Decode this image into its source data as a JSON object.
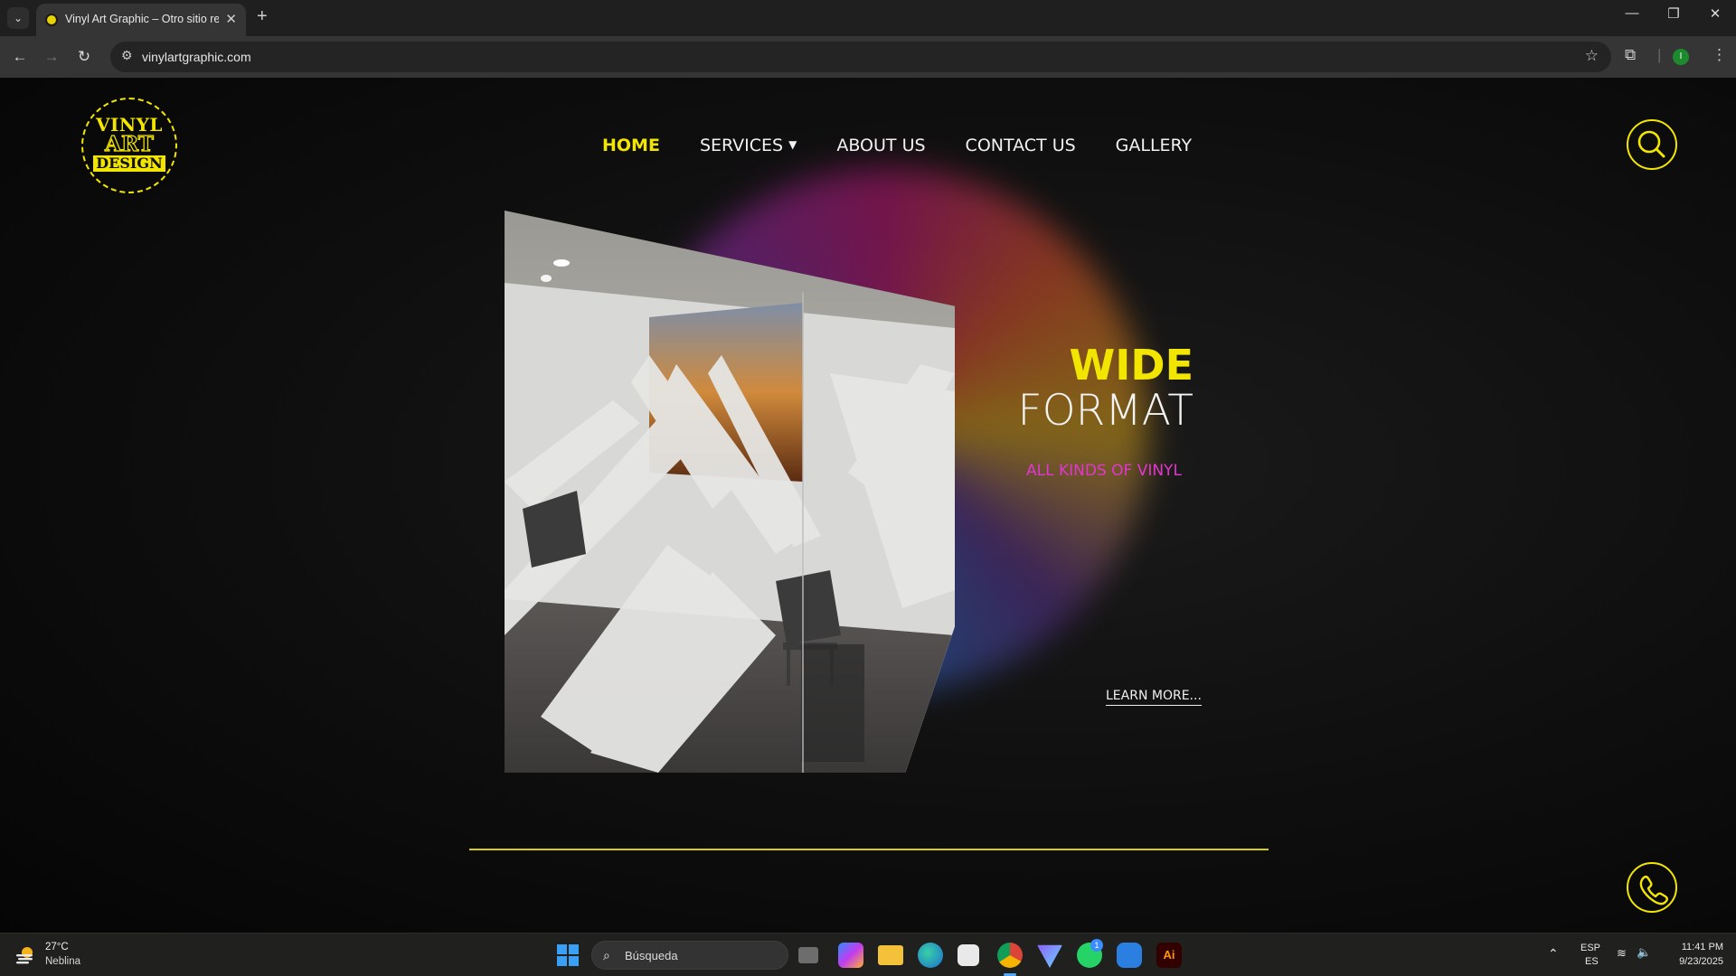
{
  "browser": {
    "tab_title": "Vinyl Art Graphic – Otro sitio re",
    "tab_close": "✕",
    "new_tab": "+",
    "address": "vinylartgraphic.com",
    "profile_initial": "I"
  },
  "site": {
    "logo": {
      "line1": "VINYL",
      "line2": "ART",
      "line3": "DESIGN"
    },
    "nav": [
      {
        "label": "HOME",
        "active": true
      },
      {
        "label": "SERVICES",
        "has_dropdown": true
      },
      {
        "label": "ABOUT US"
      },
      {
        "label": "CONTACT US"
      },
      {
        "label": "GALLERY"
      }
    ],
    "hero": {
      "title_line1": "WIDE",
      "title_line2": "FORMAT",
      "subtitle": "ALL KINDS OF VINYL",
      "cta": "LEARN MORE..."
    },
    "colors": {
      "accent": "#f2e600",
      "subtitle": "#e236d2",
      "background": "#0b0b0b"
    }
  },
  "taskbar": {
    "weather_temp": "27°C",
    "weather_desc": "Neblina",
    "search_placeholder": "Búsqueda",
    "lang_top": "ESP",
    "lang_bottom": "ES",
    "time": "11:41 PM",
    "date": "9/23/2025",
    "whatsapp_badge": "1",
    "pinned_apps": [
      "task-view",
      "copilot",
      "file-explorer",
      "edge",
      "microsoft-store",
      "chrome",
      "proton-vpn",
      "whatsapp",
      "windows-security",
      "adobe-illustrator"
    ]
  }
}
